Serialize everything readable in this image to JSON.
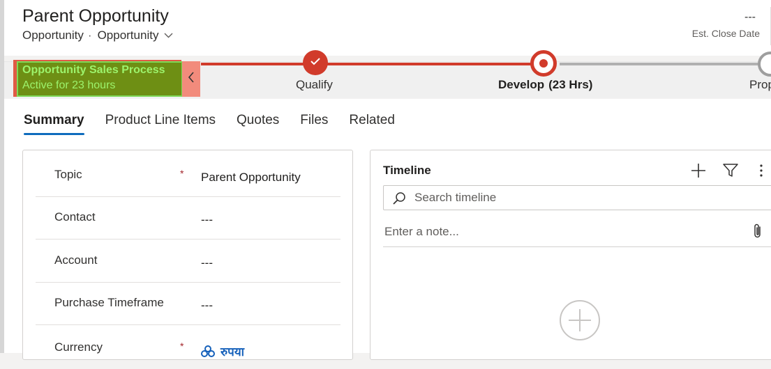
{
  "header": {
    "title": "Parent Opportunity",
    "entity": "Opportunity",
    "separator": "·",
    "form_selector": "Opportunity",
    "close_date_value": "---",
    "close_date_label": "Est. Close Date"
  },
  "process": {
    "name": "Opportunity Sales Process",
    "status": "Active for 23 hours",
    "collapse_glyph": "‹",
    "stages": [
      {
        "label": "Qualify",
        "state": "completed"
      },
      {
        "label": "Develop",
        "duration": "(23 Hrs)",
        "state": "active"
      },
      {
        "label": "Propose",
        "state": "upcoming"
      }
    ]
  },
  "tabs": [
    "Summary",
    "Product Line Items",
    "Quotes",
    "Files",
    "Related"
  ],
  "active_tab": "Summary",
  "form": {
    "fields": [
      {
        "label": "Topic",
        "required": true,
        "value": "Parent Opportunity"
      },
      {
        "label": "Contact",
        "required": false,
        "value": "---"
      },
      {
        "label": "Account",
        "required": false,
        "value": "---"
      },
      {
        "label": "Purchase Timeframe",
        "required": false,
        "value": "---"
      },
      {
        "label": "Currency",
        "required": true,
        "value": "रुपया"
      }
    ],
    "required_marker": "*"
  },
  "timeline": {
    "title": "Timeline",
    "search_placeholder": "Search timeline",
    "note_placeholder": "Enter a note..."
  },
  "colors": {
    "accent": "#0f6cbd",
    "stage_red": "#d13b2b",
    "process_highlight": "#6e8f14",
    "process_text": "#9cf36c"
  },
  "icons": [
    "check-icon",
    "chevron-down-icon",
    "chevron-left-icon",
    "add-icon",
    "filter-icon",
    "more-icon",
    "search-icon",
    "paperclip-icon",
    "currency-icon",
    "add-circle-icon"
  ]
}
